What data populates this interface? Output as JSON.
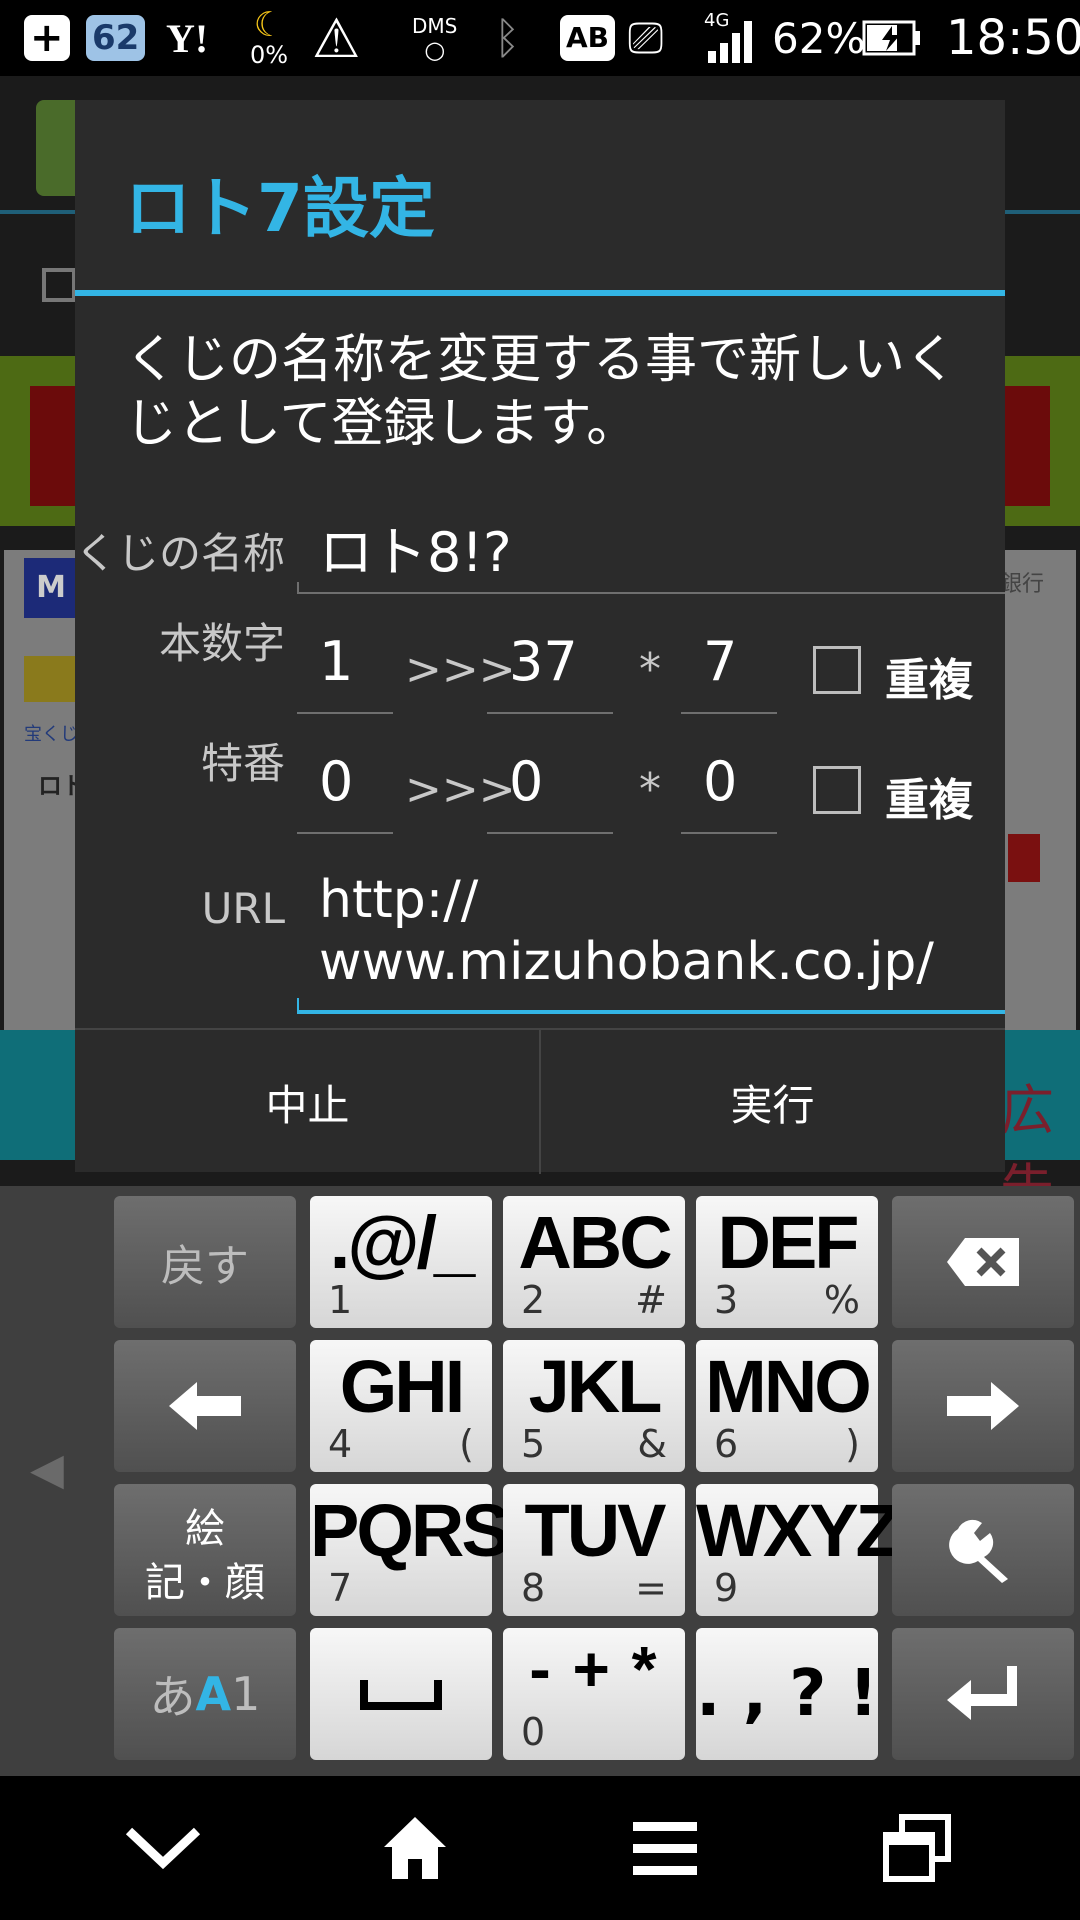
{
  "status_bar": {
    "notif_count": "62",
    "yahoo": "Y!",
    "moon_percent": "0%",
    "dms": "DMS",
    "ab": "AB",
    "network": "4G",
    "battery": "62%",
    "time": "18:50"
  },
  "background": {
    "logo_fragment": "M",
    "tab_fragment": "ロト",
    "link_fragment": "宝くじ",
    "bank_fragment": "銀行",
    "ad_fragment": "広告"
  },
  "dialog": {
    "title": "ロト7設定",
    "message": "くじの名称を変更する事で新しいくじとして登録します。",
    "name_label": "くじの名称",
    "name_value": "ロト8!?",
    "main_label": "本数字",
    "main_min": "1",
    "main_max": "37",
    "main_count": "7",
    "range_sep": ">>>",
    "times_sep": "*",
    "dup_label": "重複",
    "bonus_label": "特番",
    "bonus_min": "0",
    "bonus_max": "0",
    "bonus_count": "0",
    "url_label": "URL",
    "url_line1": "http://",
    "url_line2": "www.mizuhobank.co.jp/",
    "cancel": "中止",
    "execute": "実行"
  },
  "keyboard": {
    "undo": "戻す",
    "emoji_line1": "絵",
    "emoji_line2": "記・顔",
    "mode_a": "あ",
    "mode_b": "A",
    "mode_c": "1",
    "keys": [
      {
        "main": ".@/_",
        "num": "1",
        "sym": ""
      },
      {
        "main": "ABC",
        "num": "2",
        "sym": "#"
      },
      {
        "main": "DEF",
        "num": "3",
        "sym": "%"
      },
      {
        "main": "GHI",
        "num": "4",
        "sym": "("
      },
      {
        "main": "JKL",
        "num": "5",
        "sym": "&"
      },
      {
        "main": "MNO",
        "num": "6",
        "sym": ")"
      },
      {
        "main": "PQRS",
        "num": "7",
        "sym": ""
      },
      {
        "main": "TUV",
        "num": "8",
        "sym": "="
      },
      {
        "main": "WXYZ",
        "num": "9",
        "sym": ""
      }
    ],
    "symbols_key": "- + *",
    "symbols_num": "0",
    "punct_key": ". , ? !"
  },
  "colors": {
    "accent": "#33b5e5",
    "dialog_bg": "#2b2b2b",
    "keyboard_bg": "#3f3f3f"
  }
}
